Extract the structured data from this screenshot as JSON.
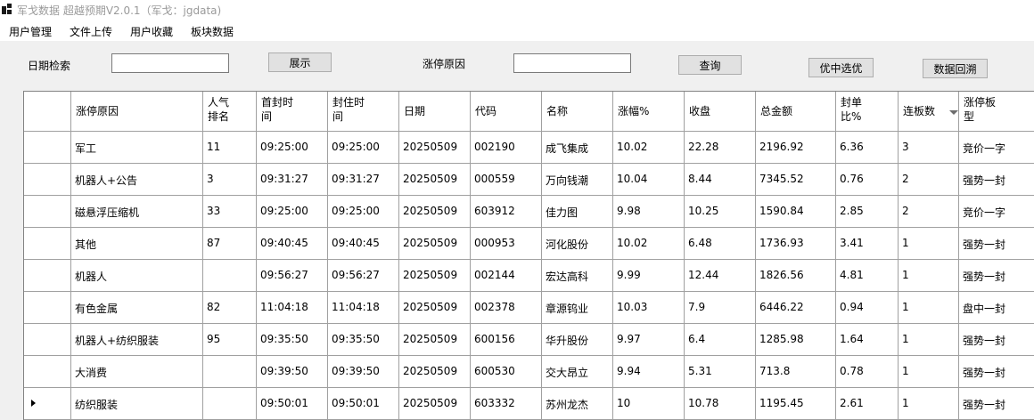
{
  "window": {
    "title": "军戈数据 超越预期V2.0.1（军戈：jgdata)"
  },
  "menu": [
    "用户管理",
    "文件上传",
    "用户收藏",
    "板块数据"
  ],
  "toolbar": {
    "date_label": "日期检索",
    "date_value": "",
    "show_button": "展示",
    "reason_label": "涨停原因",
    "reason_value": "",
    "query_button": "查询",
    "pick_button": "优中选优",
    "backtest_button": "数据回溯"
  },
  "table": {
    "columns": [
      "涨停原因",
      "人气\n排名",
      "首封时\n间",
      "封住时\n间",
      "日期",
      "代码",
      "名称",
      "涨幅%",
      "收盘",
      "总金额",
      "封单\n比%",
      "连板数",
      "涨停板\n型"
    ],
    "sorted_column": "连板数",
    "current_row_index": 8,
    "rows": [
      [
        "军工",
        "11",
        "09:25:00",
        "09:25:00",
        "20250509",
        "002190",
        "成飞集成",
        "10.02",
        "22.28",
        "2196.92",
        "6.36",
        "3",
        "竞价一字"
      ],
      [
        "机器人+公告",
        "3",
        "09:31:27",
        "09:31:27",
        "20250509",
        "000559",
        "万向钱潮",
        "10.04",
        "8.44",
        "7345.52",
        "0.76",
        "2",
        "强势一封"
      ],
      [
        "磁悬浮压缩机",
        "33",
        "09:25:00",
        "09:25:00",
        "20250509",
        "603912",
        "佳力图",
        "9.98",
        "10.25",
        "1590.84",
        "2.85",
        "2",
        "竞价一字"
      ],
      [
        "其他",
        "87",
        "09:40:45",
        "09:40:45",
        "20250509",
        "000953",
        "河化股份",
        "10.02",
        "6.48",
        "1736.93",
        "3.41",
        "1",
        "强势一封"
      ],
      [
        "机器人",
        "",
        "09:56:27",
        "09:56:27",
        "20250509",
        "002144",
        "宏达高科",
        "9.99",
        "12.44",
        "1826.56",
        "4.81",
        "1",
        "强势一封"
      ],
      [
        "有色金属",
        "82",
        "11:04:18",
        "11:04:18",
        "20250509",
        "002378",
        "章源钨业",
        "10.03",
        "7.9",
        "6446.22",
        "0.94",
        "1",
        "盘中一封"
      ],
      [
        "机器人+纺织服装",
        "95",
        "09:35:50",
        "09:35:50",
        "20250509",
        "600156",
        "华升股份",
        "9.97",
        "6.4",
        "1285.98",
        "1.64",
        "1",
        "强势一封"
      ],
      [
        "大消费",
        "",
        "09:39:50",
        "09:39:50",
        "20250509",
        "600530",
        "交大昂立",
        "9.94",
        "5.31",
        "713.8",
        "0.78",
        "1",
        "强势一封"
      ],
      [
        "纺织服装",
        "",
        "09:50:01",
        "09:50:01",
        "20250509",
        "603332",
        "苏州龙杰",
        "10",
        "10.78",
        "1195.45",
        "2.61",
        "1",
        "强势一封"
      ]
    ]
  }
}
